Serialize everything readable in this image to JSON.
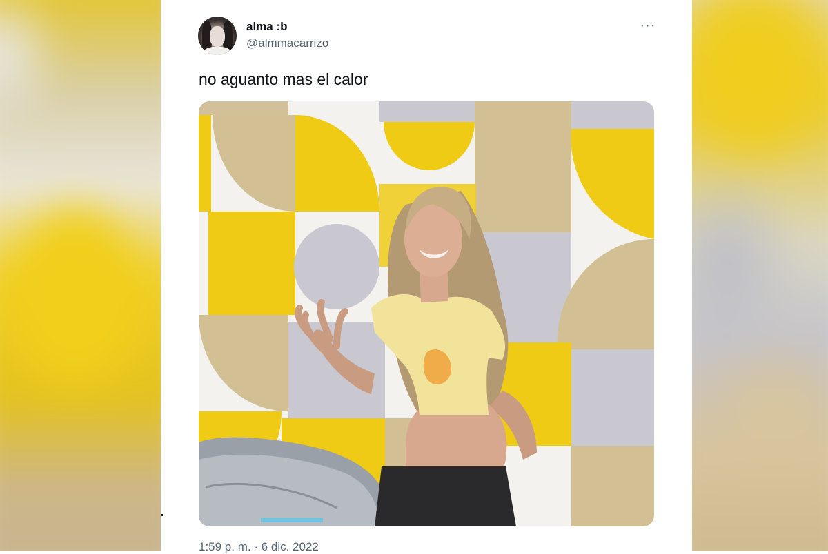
{
  "tweet": {
    "display_name": "alma :b",
    "handle": "@almmacarrizo",
    "text": "no aguanto mas el calor",
    "timestamp": "1:59 p. m. · 6 dic. 2022",
    "more_icon": "more-horizontal-icon",
    "more_label": "···"
  },
  "colors": {
    "yellow": "#efcb16",
    "tan": "#d2bf93",
    "gray": "#c4c3cc",
    "white": "#f4f3ef",
    "text_primary": "#0f1419",
    "text_secondary": "#536471"
  }
}
